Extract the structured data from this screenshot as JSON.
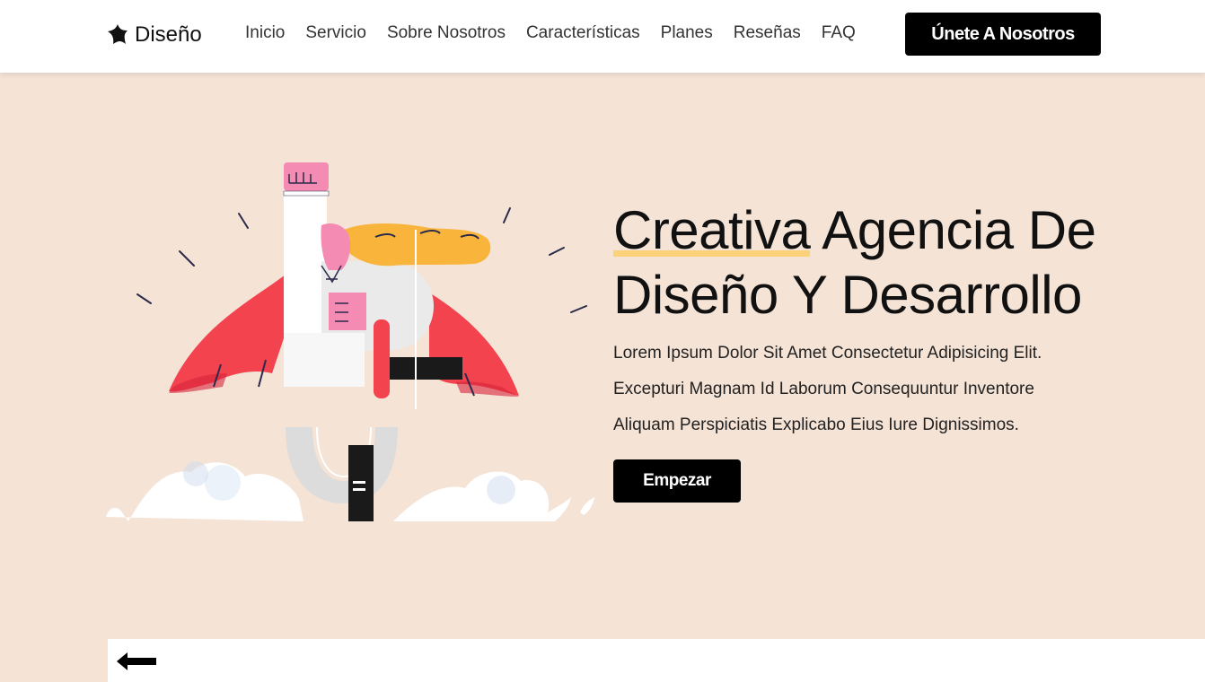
{
  "header": {
    "logo_text": "Diseño",
    "logo_icon": "star-blob-icon",
    "nav": [
      {
        "label": "Inicio"
      },
      {
        "label": "Servicio"
      },
      {
        "label": "Sobre Nosotros"
      },
      {
        "label": "Características"
      },
      {
        "label": "Planes"
      },
      {
        "label": "Reseñas"
      },
      {
        "label": "FAQ"
      }
    ],
    "cta_label": "Únete A Nosotros"
  },
  "hero": {
    "title_highlight": "Creativa",
    "title_rest_line1": " Agencia De",
    "title_line2": "Diseño Y Desarrollo",
    "description_lines": [
      "Lorem Ipsum Dolor Sit Amet Consectetur Adipisicing Elit.",
      "Excepturi Magnam Id Laborum Consequuntur Inventore",
      "Aliquam Perspiciatis Explicabo Eius Iure Dignissimos."
    ],
    "cta_label": "Empezar"
  },
  "bottom": {
    "arrow_icon": "arrow-left-icon"
  },
  "colors": {
    "background": "#f5e3d6",
    "header_bg": "#ffffff",
    "button_bg": "#000000",
    "button_text": "#ffffff",
    "highlight": "#fbd17a",
    "cape_red": "#f2434f",
    "hair_yellow": "#f9b43c",
    "skin_pink": "#f48bb2"
  }
}
